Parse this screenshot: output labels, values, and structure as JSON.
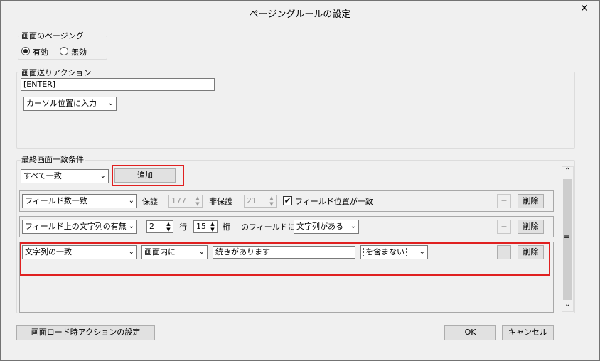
{
  "window": {
    "title": "ページングルールの設定",
    "close_glyph": "✕"
  },
  "paging": {
    "group_label": "画面のページング",
    "opt_enabled": "有効",
    "opt_disabled": "無効",
    "selected": "有効"
  },
  "action": {
    "group_label": "画面送りアクション",
    "key_value": "[ENTER]",
    "mode": "カーソル位置に入力"
  },
  "match": {
    "group_label": "最終画面一致条件",
    "mode": "すべて一致",
    "add_label": "追加",
    "rows": [
      {
        "type": "フィールド数一致",
        "protect_label": "保護",
        "protect_value": "177",
        "unprotect_label": "非保護",
        "unprotect_value": "21",
        "check_label": "フィールド位置が一致",
        "check_mark": "✔",
        "minus": "−",
        "delete": "削除"
      },
      {
        "type": "フィールド上の文字列の有無",
        "row_value": "2",
        "row_label": "行",
        "col_value": "15",
        "col_label": "桁",
        "field_label": "のフィールドに",
        "cond": "文字列がある",
        "minus": "−",
        "delete": "削除"
      },
      {
        "type": "文字列の一致",
        "scope": "画面内に",
        "text_value": "続きがあります",
        "cond": "を含まない",
        "minus": "−",
        "delete": "削除"
      }
    ]
  },
  "footer": {
    "load_action": "画面ロード時アクションの設定",
    "ok": "OK",
    "cancel": "キャンセル"
  },
  "icons": {
    "chevron": "⌄",
    "scroll_up": "⌃",
    "scroll_down": "⌄",
    "scroll_grip": "≡",
    "spin_up": "▲",
    "spin_down": "▼"
  }
}
